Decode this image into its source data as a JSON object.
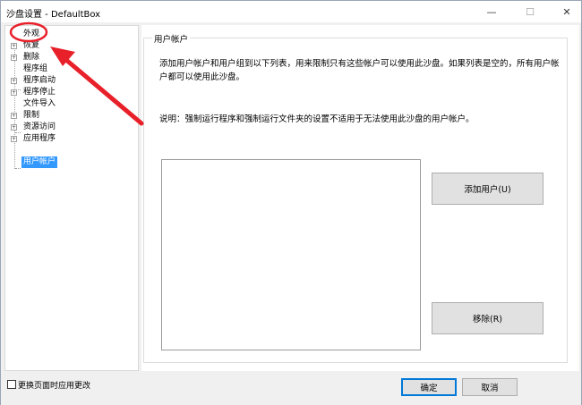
{
  "window": {
    "title": "沙盘设置 - DefaultBox",
    "minimize_glyph": "—",
    "maximize_glyph": "☐",
    "close_glyph": "✕"
  },
  "tree": {
    "items": [
      {
        "label": "外观",
        "expandable": false,
        "selected": false
      },
      {
        "label": "恢复",
        "expandable": true,
        "selected": false
      },
      {
        "label": "删除",
        "expandable": true,
        "selected": false
      },
      {
        "label": "程序组",
        "expandable": false,
        "selected": false
      },
      {
        "label": "程序启动",
        "expandable": true,
        "selected": false
      },
      {
        "label": "程序停止",
        "expandable": true,
        "selected": false
      },
      {
        "label": "文件导入",
        "expandable": false,
        "selected": false
      },
      {
        "label": "限制",
        "expandable": true,
        "selected": false
      },
      {
        "label": "资源访问",
        "expandable": true,
        "selected": false
      },
      {
        "label": "应用程序",
        "expandable": true,
        "selected": false
      },
      {
        "label": "用户帐户",
        "expandable": false,
        "selected": true
      }
    ]
  },
  "content": {
    "group_title": "用户帐户",
    "description": "添加用户帐户和用户组到以下列表，用来限制只有这些帐户可以使用此沙盘。如果列表是空的，所有用户帐户都可以使用此沙盘。",
    "note": "说明：强制运行程序和强制运行文件夹的设置不适用于无法使用此沙盘的用户帐户。",
    "add_button": "添加用户(U)",
    "remove_button": "移除(R)"
  },
  "bottom": {
    "checkbox_label": "更换页面时应用更改",
    "checkbox_checked": false,
    "ok_button": "确定",
    "cancel_button": "取消"
  },
  "colors": {
    "annotation_red": "#e8202a",
    "selection_blue": "#3399ff"
  }
}
